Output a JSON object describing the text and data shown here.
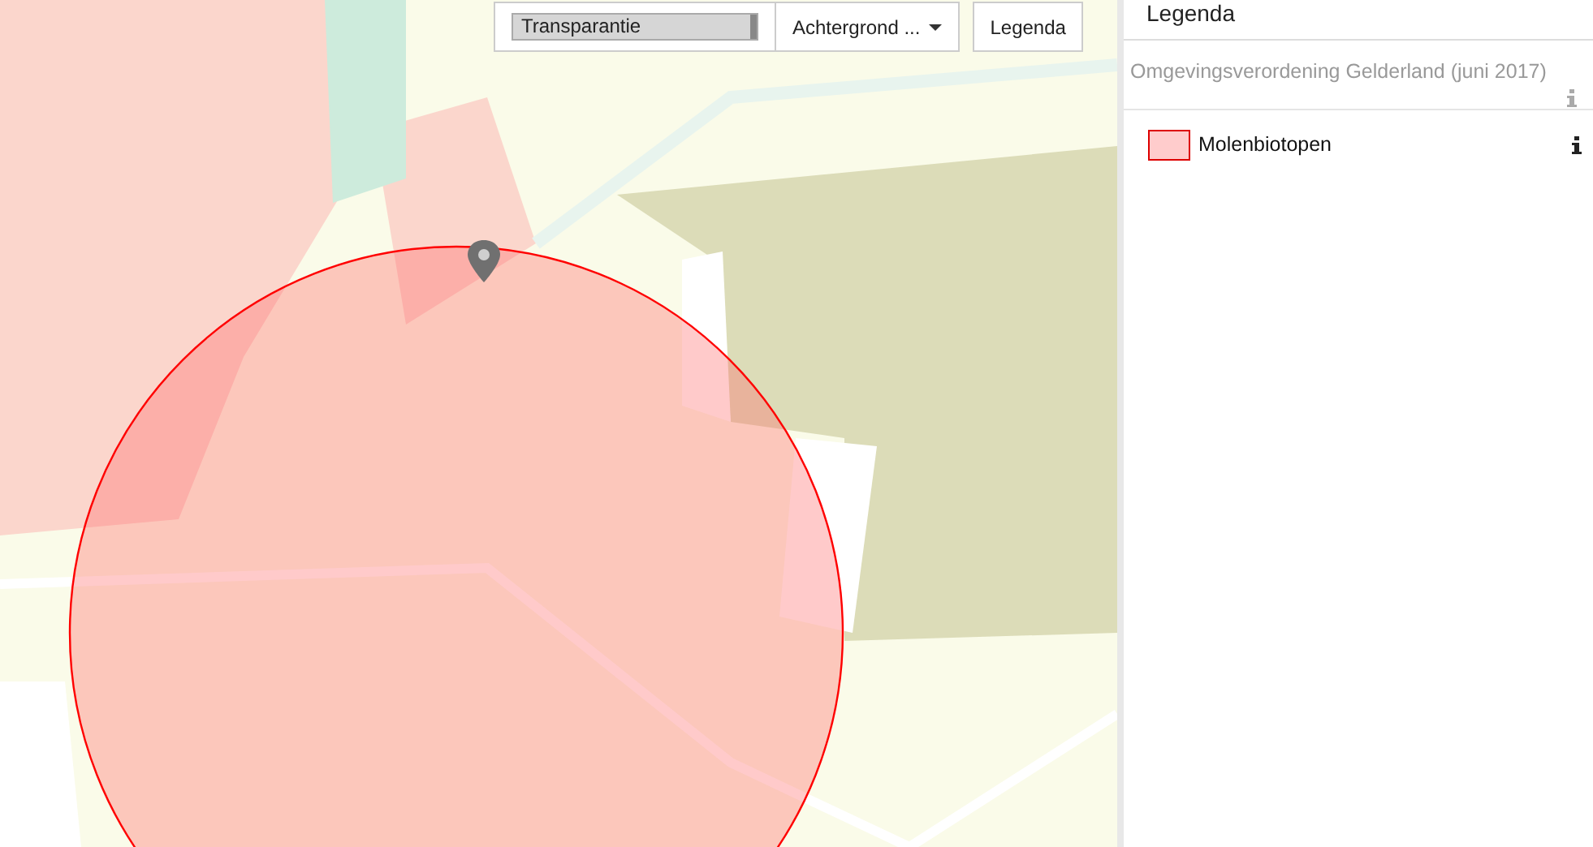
{
  "map_controls": {
    "transparency": {
      "label": "Transparantie",
      "level": 1
    },
    "background_button": {
      "label": "Achtergrond ..."
    },
    "legend_button": {
      "label": "Legenda"
    }
  },
  "legend_panel": {
    "title": "Legenda",
    "groups": [
      {
        "title": "Omgevingsverordening Gelderland (juni 2017)",
        "items": [
          {
            "label": "Molenbiotopen",
            "color": "#ffcccc"
          }
        ]
      }
    ]
  }
}
